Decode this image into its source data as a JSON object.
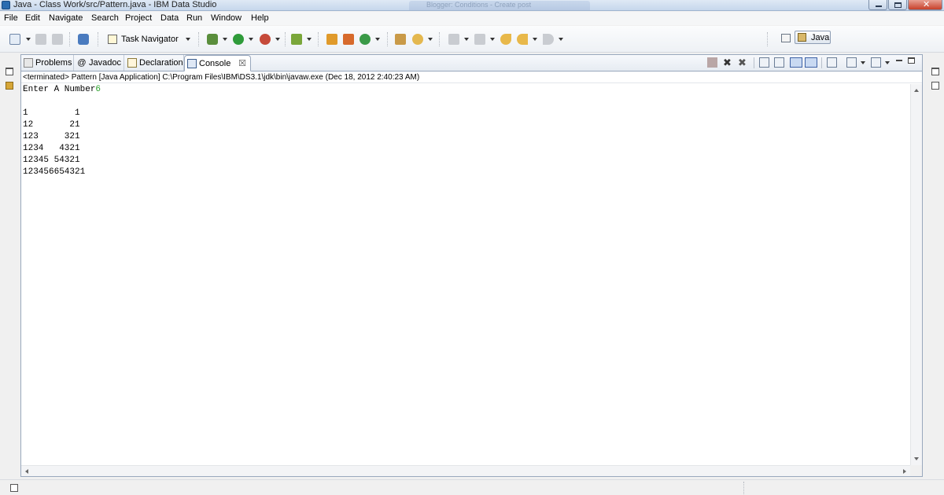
{
  "window": {
    "title": "Java - Class Work/src/Pattern.java - IBM Data Studio",
    "background_tab_title": "Blogger: Conditions - Create post"
  },
  "menu": [
    "File",
    "Edit",
    "Navigate",
    "Search",
    "Project",
    "Data",
    "Run",
    "Window",
    "Help"
  ],
  "toolbar": {
    "task_navigator_label": "Task Navigator",
    "perspective_label": "Java"
  },
  "tabs": [
    {
      "label": "Problems",
      "icon": "problems-icon"
    },
    {
      "label": "Javadoc",
      "icon": "javadoc-icon"
    },
    {
      "label": "Declaration",
      "icon": "declaration-icon"
    },
    {
      "label": "Console",
      "icon": "console-icon",
      "active": true
    }
  ],
  "console": {
    "status": "<terminated> Pattern [Java Application] C:\\Program Files\\IBM\\DS3.1\\jdk\\bin\\javaw.exe (Dec 18, 2012 2:40:23 AM)",
    "prompt": "Enter A Number",
    "input": "6",
    "output_lines": [
      "",
      "1         1",
      "12       21",
      "123     321",
      "1234   4321",
      "12345 54321",
      "123456654321"
    ]
  },
  "colors": {
    "input_echo": "#2aa12a",
    "panel_border": "#99a8bd",
    "title_gradient_top": "#dfe9f5"
  }
}
